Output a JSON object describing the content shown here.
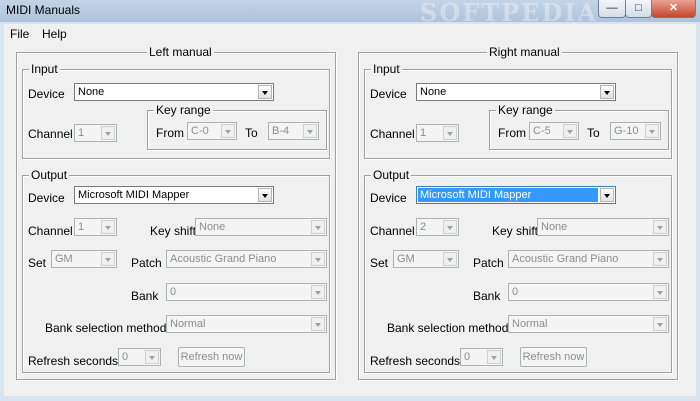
{
  "window": {
    "title": "MIDI Manuals",
    "watermark": "SOFTPEDIA"
  },
  "caption_buttons": {
    "minimize": "—",
    "maximize": "□",
    "close": "✕"
  },
  "menu": {
    "file": "File",
    "help": "Help"
  },
  "labels": {
    "input": "Input",
    "output": "Output",
    "device": "Device",
    "channel": "Channel",
    "key_range": "Key range",
    "from": "From",
    "to": "To",
    "key_shift": "Key shift",
    "set": "Set",
    "patch": "Patch",
    "bank": "Bank",
    "bank_selection_method": "Bank selection method",
    "refresh_seconds": "Refresh seconds",
    "refresh_now": "Refresh now"
  },
  "left": {
    "title": "Left manual",
    "input": {
      "device": "None",
      "channel": "1",
      "from": "C-0",
      "to": "B-4"
    },
    "output": {
      "device": "Microsoft MIDI Mapper",
      "channel": "1",
      "key_shift": "None",
      "set": "GM",
      "patch": "Acoustic Grand Piano",
      "bank": "0",
      "bank_method": "Normal",
      "refresh": "0"
    }
  },
  "right": {
    "title": "Right manual",
    "input": {
      "device": "None",
      "channel": "1",
      "from": "C-5",
      "to": "G-10"
    },
    "output": {
      "device": "Microsoft MIDI Mapper",
      "channel": "2",
      "key_shift": "None",
      "set": "GM",
      "patch": "Acoustic Grand Piano",
      "bank": "0",
      "bank_method": "Normal",
      "refresh": "0"
    }
  }
}
